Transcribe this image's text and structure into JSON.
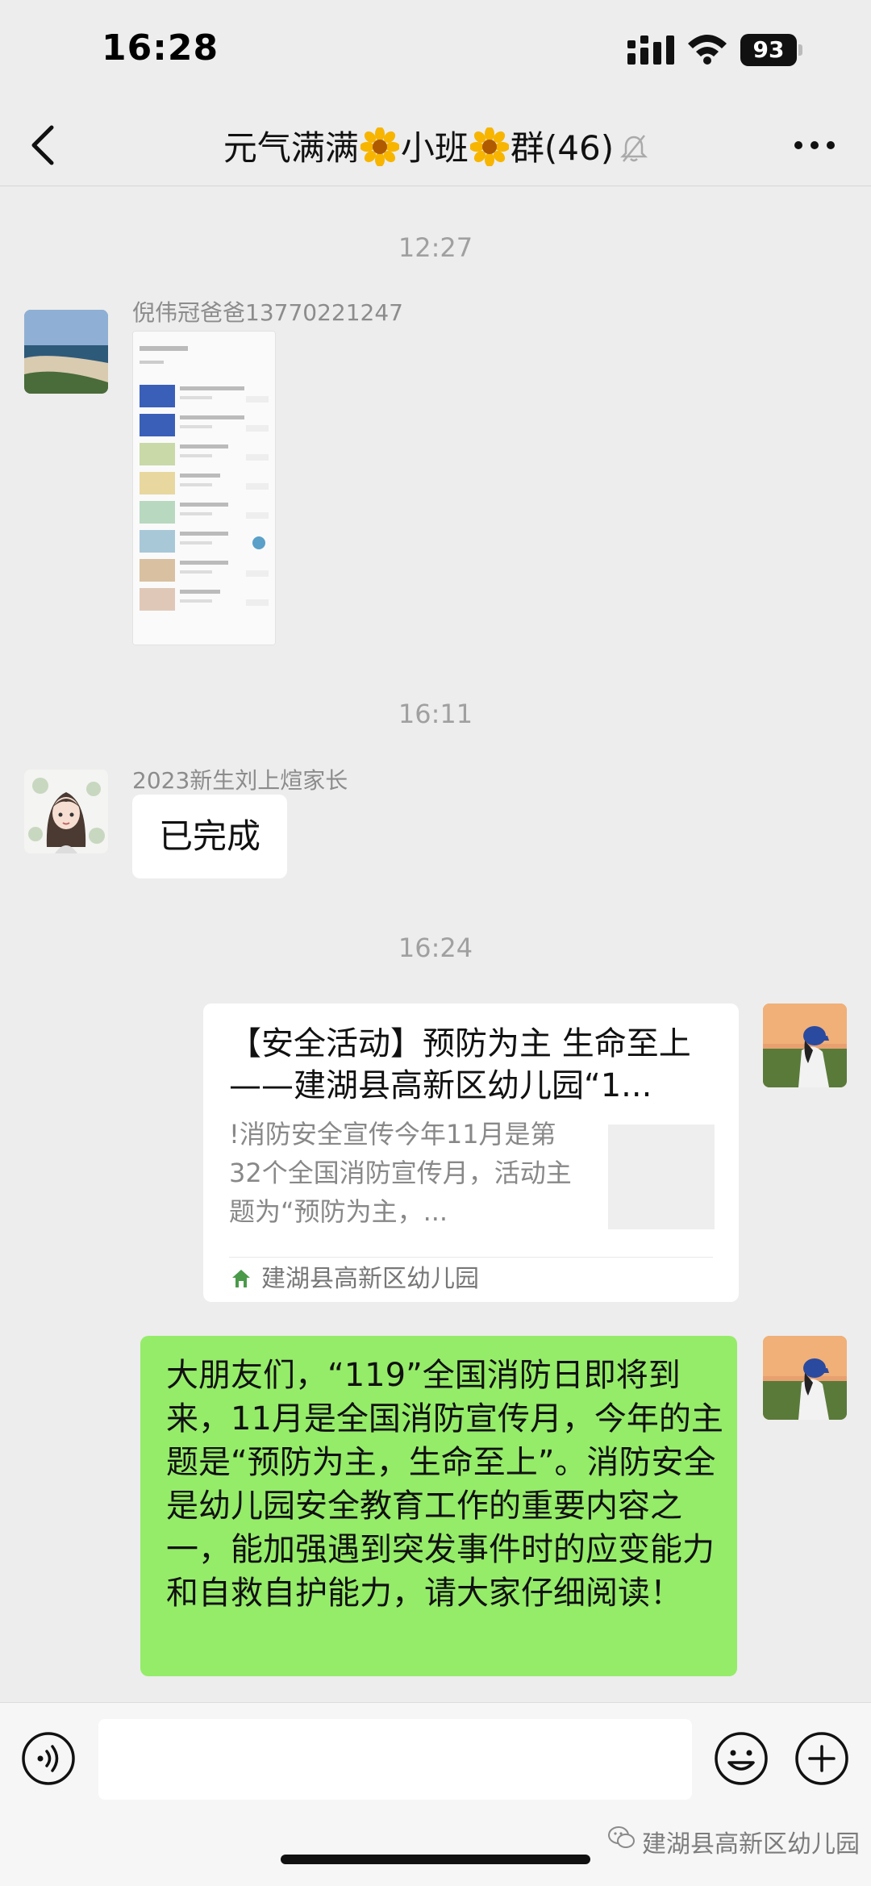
{
  "status_bar": {
    "time": "16:28",
    "battery": "93"
  },
  "nav": {
    "title_part1": "元气满满",
    "title_part2": "小班",
    "title_part3": "群(46)"
  },
  "messages": {
    "time1": "12:27",
    "sender1": "倪伟冠爸爸13770221247",
    "time2": "16:11",
    "sender2": "2023新生刘上煊家长",
    "text_done": "已完成",
    "time3": "16:24",
    "card": {
      "title": "【安全活动】预防为主  生命至上——建湖县高新区幼儿园“1...",
      "desc": "!消防安全宣传今年11月是第32个全国消防宣传月，活动主题为“预防为主，...",
      "source": "建湖县高新区幼儿园"
    },
    "green_text": "大朋友们，“119”全国消防日即将到来，11月是全国消防宣传月，今年的主题是“预防为主，生命至上”。消防安全是幼儿园安全教育工作的重要内容之一，能加强遇到突发事件时的应变能力和自救自护能力，请大家仔细阅读！"
  },
  "input": {
    "value": ""
  },
  "watermark": "建湖县高新区幼儿园",
  "colors": {
    "background": "#ededed",
    "green_bubble": "#95ec69",
    "white_bubble": "#ffffff"
  }
}
